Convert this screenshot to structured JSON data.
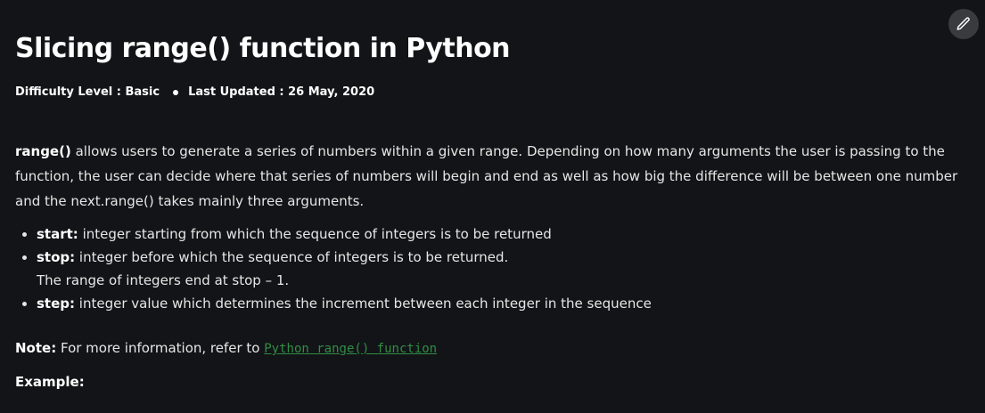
{
  "article": {
    "title": "Slicing range() function in Python",
    "meta": {
      "difficulty": "Difficulty Level : Basic",
      "updated": "Last Updated : 26 May, 2020"
    },
    "intro": {
      "term": "range()",
      "text": " allows users to generate a series of numbers within a given range. Depending on how many arguments the user is passing to the function, the user can decide where that series of numbers will begin and end as well as how big the difference will be between one number and the next.range() takes mainly three arguments."
    },
    "arguments": [
      {
        "name": "start:",
        "desc": " integer starting from which the sequence of integers is to be returned",
        "extra": ""
      },
      {
        "name": "stop:",
        "desc": " integer before which the sequence of integers is to be returned.",
        "extra": "The range of integers end at stop – 1."
      },
      {
        "name": "step:",
        "desc": " integer value which determines the increment between each integer in the sequence",
        "extra": ""
      }
    ],
    "note": {
      "label": "Note:",
      "text": " For more information, refer to ",
      "link": "Python range() function"
    },
    "example_label": "Example:"
  },
  "toolbar": {
    "edit_icon": "pencil-icon"
  }
}
